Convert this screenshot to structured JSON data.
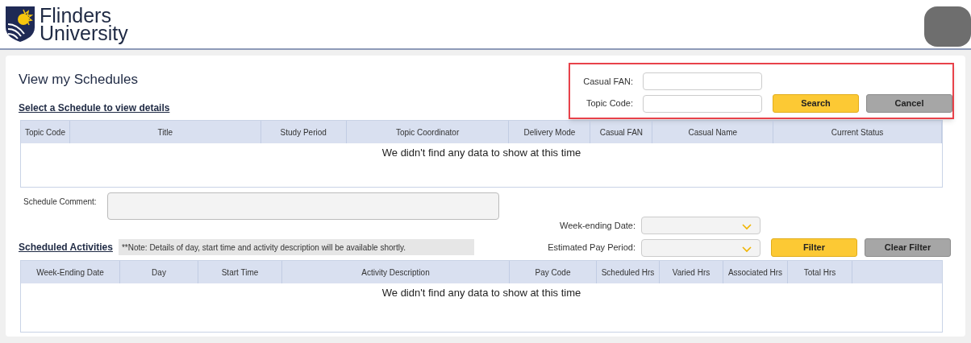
{
  "logo": {
    "line1": "Flinders",
    "line2": "University"
  },
  "page_title": "View my Schedules",
  "schedule_link": "Select a Schedule to view details",
  "search_form": {
    "fields": [
      {
        "label": "Casual FAN:"
      },
      {
        "label": "Topic Code:"
      }
    ],
    "search_button": "Search",
    "cancel_button": "Cancel"
  },
  "schedules_table": {
    "columns": [
      "Topic Code",
      "Title",
      "Study Period",
      "Topic Coordinator",
      "Delivery Mode",
      "Casual FAN",
      "Casual Name",
      "Current Status"
    ],
    "empty_message": "We didn't find any data to show at this time"
  },
  "schedule_comment": {
    "label": "Schedule Comment:"
  },
  "activities_link": "Scheduled Activities",
  "activities_note": "**Note: Details of day, start time and activity description will be available shortly.",
  "filter_form": {
    "selects": [
      {
        "label": "Week-ending Date:"
      },
      {
        "label": "Estimated Pay Period:"
      }
    ],
    "filter_button": "Filter",
    "clear_button": "Clear Filter"
  },
  "activities_table": {
    "columns": [
      "Week-Ending Date",
      "Day",
      "Start Time",
      "Activity Description",
      "Pay Code",
      "Scheduled Hrs",
      "Varied Hrs",
      "Associated Hrs",
      "Total Hrs"
    ],
    "empty_message": "We didn't find any data to show at this time"
  }
}
